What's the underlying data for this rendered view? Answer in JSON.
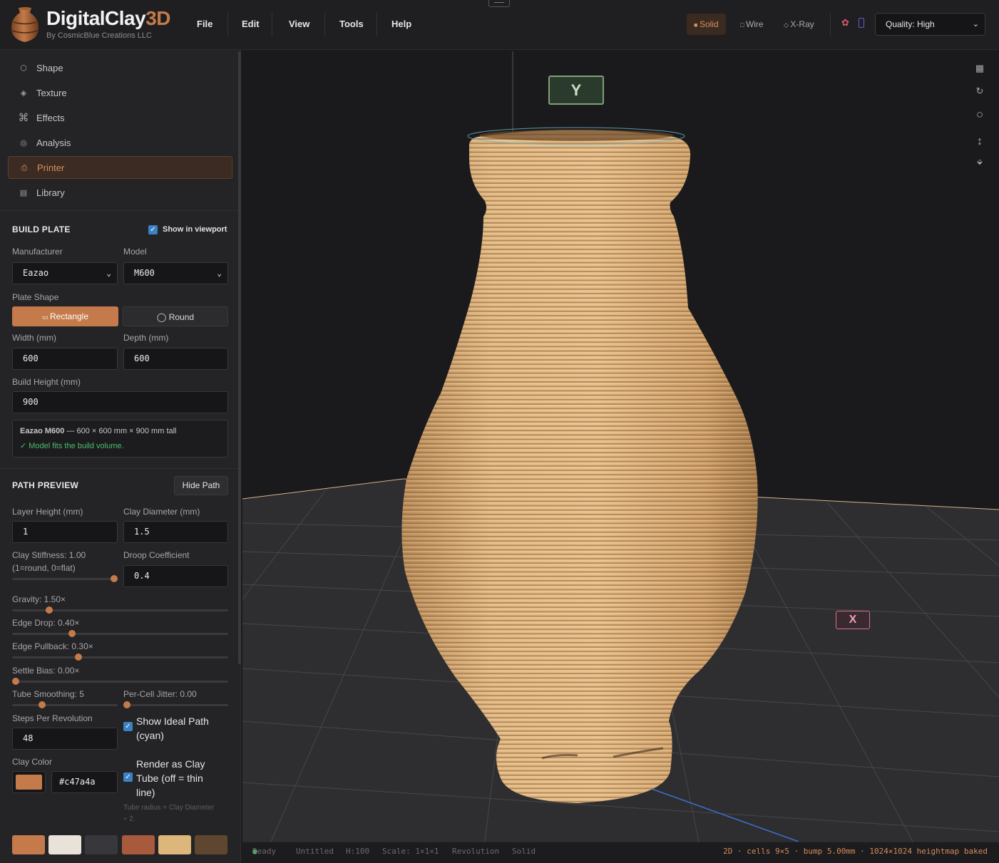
{
  "app": {
    "name_main": "DigitalClay",
    "name_accent": "3D",
    "subtitle": "By CosmicBlue Creations LLC",
    "accent_color": "#c47a4a"
  },
  "menubar": [
    "File",
    "Edit",
    "View",
    "Tools",
    "Help"
  ],
  "render_modes": {
    "solid": "Solid",
    "wire": "Wire",
    "xray": "X-Ray",
    "active": "Solid"
  },
  "quality": {
    "value": "Quality: High"
  },
  "icons": {
    "shape": "hexagon-icon",
    "texture": "diamond-icon",
    "effects": "command-icon",
    "analysis": "target-icon",
    "printer": "printer-icon",
    "library": "library-icon",
    "palette": "palette-icon",
    "grid": "grid-icon",
    "rotate": "rotate-icon",
    "circle": "circle-icon",
    "updown": "vertical-arrows-icon",
    "collapse": "collapse-icon"
  },
  "nav": {
    "shape": "Shape",
    "texture": "Texture",
    "effects": "Effects",
    "analysis": "Analysis",
    "printer": "Printer",
    "library": "Library",
    "active": "Printer"
  },
  "build_plate": {
    "title": "BUILD PLATE",
    "show_in_viewport": "Show in viewport",
    "manufacturer_label": "Manufacturer",
    "manufacturer": "Eazao",
    "model_label": "Model",
    "model": "M600",
    "plate_shape_label": "Plate Shape",
    "rectangle": "Rectangle",
    "round": "Round",
    "width_label": "Width (mm)",
    "width": "600",
    "depth_label": "Depth (mm)",
    "depth": "600",
    "height_label": "Build Height (mm)",
    "height": "900",
    "summary_name": "Eazao M600",
    "summary_dims": " — 600 × 600 mm × 900 mm tall",
    "fit_status": "✓ Model fits the build volume."
  },
  "path_preview": {
    "title": "PATH PREVIEW",
    "hide_button": "Hide Path",
    "layer_height_label": "Layer Height (mm)",
    "layer_height": "1",
    "clay_diameter_label": "Clay Diameter (mm)",
    "clay_diameter": "1.5",
    "stiffness_label": "Clay Stiffness: 1.00",
    "stiffness_sub": "(1=round, 0=flat)",
    "stiffness_value": 1.0,
    "droop_label": "Droop Coefficient",
    "droop": "0.4",
    "gravity_label": "Gravity: 1.50×",
    "gravity_fraction": 0.16,
    "edge_drop_label": "Edge Drop: 0.40×",
    "edge_drop_fraction": 0.27,
    "edge_pullback_label": "Edge Pullback: 0.30×",
    "edge_pullback_fraction": 0.3,
    "settle_bias_label": "Settle Bias: 0.00×",
    "settle_bias_fraction": 0.0,
    "tube_smoothing_label": "Tube Smoothing: 5",
    "tube_smoothing_fraction": 0.27,
    "jitter_label": "Per-Cell Jitter: 0.00",
    "jitter_fraction": 0.0,
    "steps_label": "Steps Per Revolution",
    "steps": "48",
    "show_ideal_line1": "Show Ideal Path",
    "show_ideal_line2": "(cyan)",
    "clay_color_label": "Clay Color",
    "clay_color": "#c47a4a",
    "render_tube_line1": "Render as Clay",
    "render_tube_line2": "Tube (off = thin",
    "render_tube_line3": "line)",
    "tube_note_line1": "Tube radius = Clay Diameter",
    "tube_note_line2": "÷ 2.",
    "swatches": [
      "#c47a4a",
      "#e8e2d8",
      "#38383c",
      "#a85a3c",
      "#dcb67a",
      "#5e4630"
    ]
  },
  "viewport": {
    "axis_y": "Y",
    "axis_x": "X",
    "clay_color": "#dcb07c"
  },
  "status": {
    "ready": "Ready",
    "file": "Untitled",
    "height": "H:100",
    "scale": "Scale: 1×1×1",
    "mode": "Revolution",
    "render": "Solid",
    "right": "2D · cells 9×5 · bump 5.00mm · 1024×1024 heightmap baked"
  }
}
